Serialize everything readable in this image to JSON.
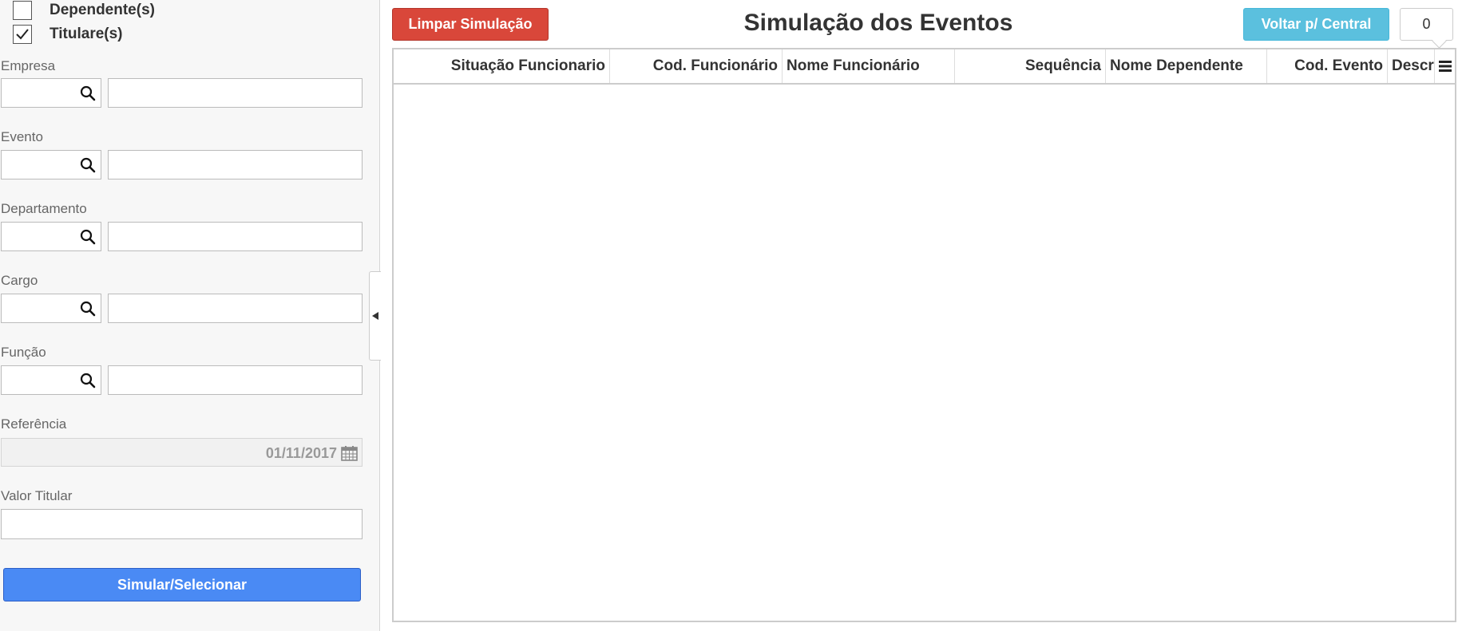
{
  "filters": {
    "dependentes_label": "Dependente(s)",
    "dependentes_checked": false,
    "titulares_label": "Titulare(s)",
    "titulares_checked": true,
    "empresa_label": "Empresa",
    "evento_label": "Evento",
    "departamento_label": "Departamento",
    "cargo_label": "Cargo",
    "funcao_label": "Função",
    "referencia_label": "Referência",
    "referencia_value": "01/11/2017",
    "valor_titular_label": "Valor Titular",
    "simulate_label": "Simular/Selecionar"
  },
  "header": {
    "clear_label": "Limpar Simulação",
    "title": "Simulação dos Eventos",
    "back_label": "Voltar p/ Central",
    "count": "0"
  },
  "grid": {
    "columns": [
      "Situação Funcionario",
      "Cod. Funcionário",
      "Nome Funcionário",
      "Sequência",
      "Nome Dependente",
      "Cod. Evento",
      "Descr"
    ],
    "rows": []
  },
  "icons": {
    "search": "search-icon",
    "calendar": "calendar-icon",
    "check": "checkmark-icon",
    "collapse": "triangle-left-icon",
    "menu": "menu-icon"
  },
  "colors": {
    "danger": "#d9473a",
    "info": "#5bc0de",
    "primary": "#4a8af4"
  }
}
